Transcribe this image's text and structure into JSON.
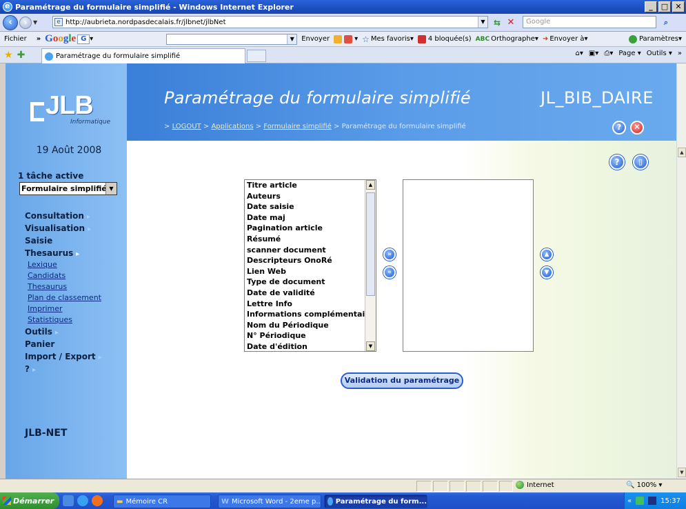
{
  "window": {
    "title": "Paramétrage du formulaire simplifié - Windows Internet Explorer",
    "min": "_",
    "max": "□",
    "close": "✕"
  },
  "addressbar": {
    "url": "http://aubrieta.nordpasdecalais.fr/jlbnet/jlbNet",
    "search_placeholder": "Google"
  },
  "google_toolbar": {
    "fichier": "Fichier",
    "chevron": "»",
    "google_letters": [
      "G",
      "o",
      "o",
      "g",
      "l",
      "e"
    ],
    "g_dropdown": "G",
    "envoyer": "Envoyer",
    "mes_favoris": "Mes favoris",
    "bloquees": "4 bloquée(s)",
    "orthographe": "Orthographe",
    "envoyer_a": "Envoyer à",
    "parametres": "Paramètres"
  },
  "tab": {
    "label": "Paramétrage du formulaire simplifié",
    "page_menu": "Page",
    "tools_menu": "Outils"
  },
  "app": {
    "logo_text": "JLB",
    "logo_sub": "Informatique",
    "date": "19 Août 2008",
    "active_tasks": "1 tâche active",
    "task_select": "Formulaire simplifié",
    "menu": [
      {
        "label": "Consultation",
        "chev": "▸"
      },
      {
        "label": "Visualisation",
        "chev": "▸"
      },
      {
        "label": "Saisie",
        "chev": ""
      },
      {
        "label": "Thesaurus",
        "chev": "▸"
      }
    ],
    "submenu": [
      "Lexique",
      "Candidats",
      "Thesaurus",
      "Plan de classement",
      "Imprimer",
      "Statistiques"
    ],
    "menu2": [
      {
        "label": "Outils",
        "chev": "▸"
      },
      {
        "label": "Panier",
        "chev": ""
      },
      {
        "label": "Import / Export",
        "chev": "▸"
      },
      {
        "label": "?",
        "chev": "▸"
      }
    ],
    "brand": "JLB-NET",
    "page_title": "Paramétrage du formulaire simplifié",
    "user": "JL_BIB_DAIRE",
    "breadcrumb": {
      "sep": " > ",
      "logout": "LOGOUT",
      "applications": "Applications",
      "formulaire": "Formulaire simplifié",
      "current": "Paramétrage du formulaire simplifié"
    }
  },
  "fields_available": [
    "Titre article",
    "Auteurs",
    "Date saisie",
    "Date maj",
    "Pagination article",
    "Résumé",
    "scanner document",
    "Descripteurs OnoRé",
    "Lien Web",
    "Type de document",
    "Date de validité",
    "Lettre Info",
    "Informations complémentai",
    "Nom du Périodique",
    "N° Périodique",
    "Date d'édition"
  ],
  "validate_label": "Validation du paramétrage",
  "statusbar": {
    "zone": "Internet",
    "zoom": "100%"
  },
  "taskbar": {
    "start": "Démarrer",
    "tasks": [
      "Mémoire CR",
      "Microsoft Word - 2eme p...",
      "Paramétrage du form..."
    ],
    "chevron": "«",
    "clock": "15:37"
  },
  "icons": {
    "help": "?",
    "close": "✕",
    "book": "▯",
    "move_right": "»",
    "move_left": "«",
    "move_up": "▲",
    "move_down": "▼"
  }
}
